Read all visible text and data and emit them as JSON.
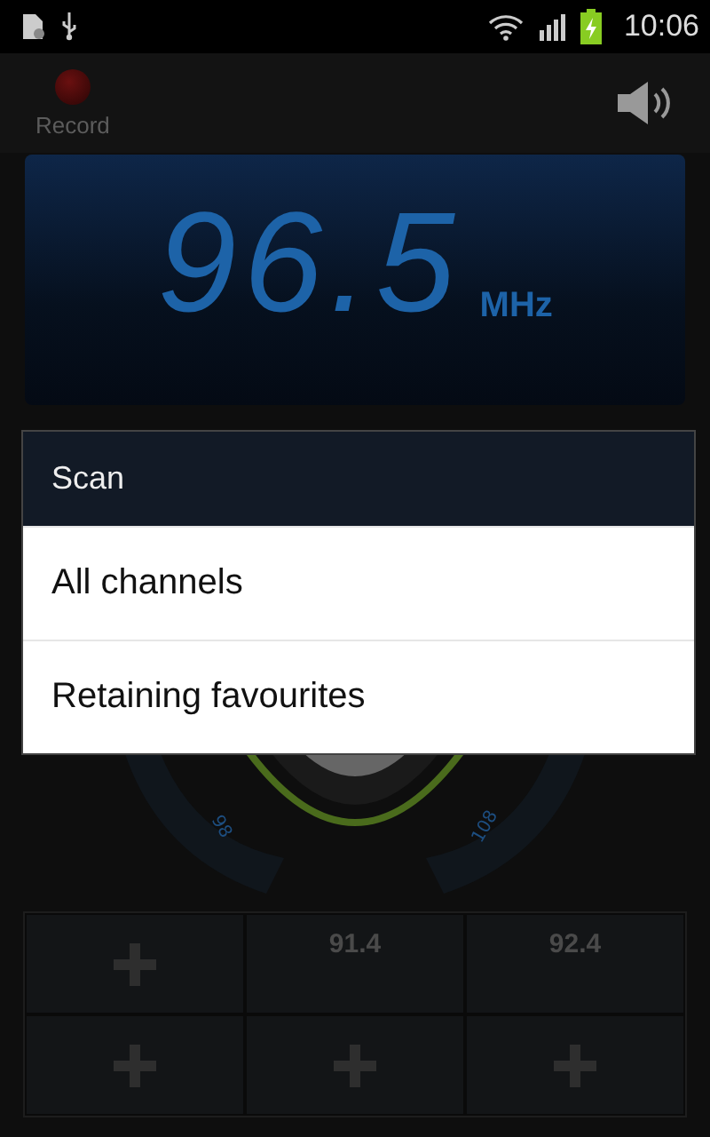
{
  "status_bar": {
    "time": "10:06"
  },
  "record": {
    "label": "Record"
  },
  "display": {
    "frequency": "96.5",
    "unit": "MHz"
  },
  "dial": {
    "labels": [
      "98",
      "108"
    ]
  },
  "dialog": {
    "title": "Scan",
    "options": [
      {
        "label": "All channels"
      },
      {
        "label": "Retaining favourites"
      }
    ]
  },
  "presets": [
    {
      "kind": "add"
    },
    {
      "kind": "station",
      "frequency": "91.4"
    },
    {
      "kind": "station",
      "frequency": "92.4"
    },
    {
      "kind": "add"
    },
    {
      "kind": "add"
    },
    {
      "kind": "add"
    }
  ]
}
